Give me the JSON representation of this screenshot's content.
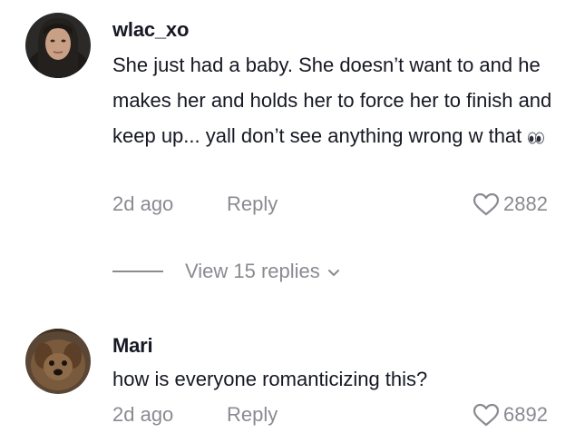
{
  "comments": [
    {
      "username": "wlac_xo",
      "text": "She just had a baby. She doesn’t want to and he makes her and holds her to force her to finish and keep up... yall don’t see anything wrong w that",
      "emoji_icon": "eyes-emoji-icon",
      "timestamp": "2d ago",
      "reply_label": "Reply",
      "likes": "2882",
      "view_replies_label": "View 15 replies"
    },
    {
      "username": "Mari",
      "text": "how is everyone romanticizing this?",
      "timestamp": "2d ago",
      "reply_label": "Reply",
      "likes": "6892"
    }
  ],
  "colors": {
    "text_primary": "#161823",
    "text_secondary": "#8a8b91",
    "background": "#ffffff"
  }
}
